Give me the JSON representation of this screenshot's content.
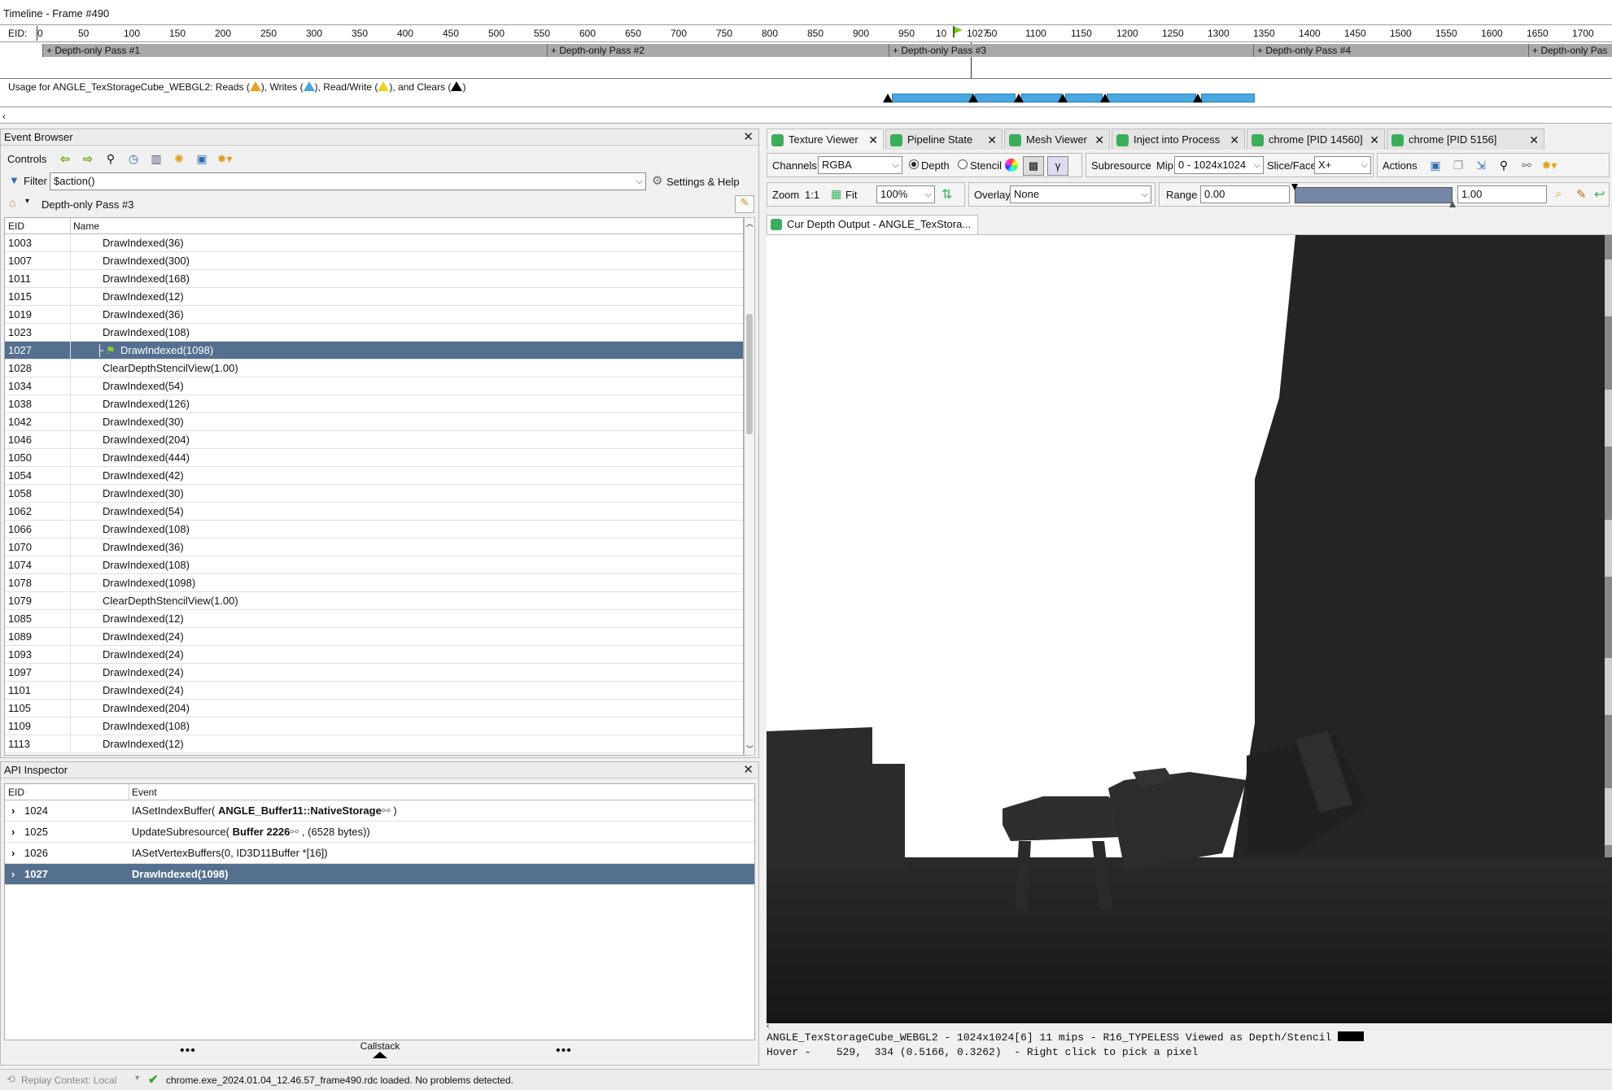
{
  "timeline": {
    "title": "Timeline - Frame #490",
    "eid_label": "EID:",
    "ticks": [
      "0",
      "50",
      "100",
      "150",
      "200",
      "250",
      "300",
      "350",
      "400",
      "450",
      "500",
      "550",
      "600",
      "650",
      "700",
      "750",
      "800",
      "850",
      "900",
      "950",
      "10",
      "1027",
      "50",
      "1100",
      "1150",
      "1200",
      "1250",
      "1300",
      "1350",
      "1400",
      "1450",
      "1500",
      "1550",
      "1600",
      "1650",
      "1700"
    ],
    "passes": [
      "+ Depth-only Pass #1",
      "+ Depth-only Pass #2",
      "+ Depth-only Pass #3",
      "+ Depth-only Pass #4",
      "+ Depth-only Pas"
    ],
    "usage": {
      "prefix": "Usage for ANGLE_TexStorageCube_WEBGL2: Reads (",
      "writes": "), Writes (",
      "readwrite": "), Read/Write (",
      "clears": "), and Clears (",
      "suffix": ")"
    }
  },
  "event_browser": {
    "title": "Event Browser",
    "controls_label": "Controls",
    "filter_label": "Filter",
    "filter_value": "$action()",
    "settings_label": "Settings & Help",
    "breadcrumb": "Depth-only Pass #3",
    "col_eid": "EID",
    "col_name": "Name",
    "rows": [
      {
        "eid": "1003",
        "name": "DrawIndexed(36)"
      },
      {
        "eid": "1007",
        "name": "DrawIndexed(300)"
      },
      {
        "eid": "1011",
        "name": "DrawIndexed(168)"
      },
      {
        "eid": "1015",
        "name": "DrawIndexed(12)"
      },
      {
        "eid": "1019",
        "name": "DrawIndexed(36)"
      },
      {
        "eid": "1023",
        "name": "DrawIndexed(108)"
      },
      {
        "eid": "1027",
        "name": "DrawIndexed(1098)"
      },
      {
        "eid": "1028",
        "name": "ClearDepthStencilView(1.00)"
      },
      {
        "eid": "1034",
        "name": "DrawIndexed(54)"
      },
      {
        "eid": "1038",
        "name": "DrawIndexed(126)"
      },
      {
        "eid": "1042",
        "name": "DrawIndexed(30)"
      },
      {
        "eid": "1046",
        "name": "DrawIndexed(204)"
      },
      {
        "eid": "1050",
        "name": "DrawIndexed(444)"
      },
      {
        "eid": "1054",
        "name": "DrawIndexed(42)"
      },
      {
        "eid": "1058",
        "name": "DrawIndexed(30)"
      },
      {
        "eid": "1062",
        "name": "DrawIndexed(54)"
      },
      {
        "eid": "1066",
        "name": "DrawIndexed(108)"
      },
      {
        "eid": "1070",
        "name": "DrawIndexed(36)"
      },
      {
        "eid": "1074",
        "name": "DrawIndexed(108)"
      },
      {
        "eid": "1078",
        "name": "DrawIndexed(1098)"
      },
      {
        "eid": "1079",
        "name": "ClearDepthStencilView(1.00)"
      },
      {
        "eid": "1085",
        "name": "DrawIndexed(12)"
      },
      {
        "eid": "1089",
        "name": "DrawIndexed(24)"
      },
      {
        "eid": "1093",
        "name": "DrawIndexed(24)"
      },
      {
        "eid": "1097",
        "name": "DrawIndexed(24)"
      },
      {
        "eid": "1101",
        "name": "DrawIndexed(24)"
      },
      {
        "eid": "1105",
        "name": "DrawIndexed(204)"
      },
      {
        "eid": "1109",
        "name": "DrawIndexed(108)"
      },
      {
        "eid": "1113",
        "name": "DrawIndexed(12)"
      }
    ]
  },
  "api_inspector": {
    "title": "API Inspector",
    "col_eid": "EID",
    "col_event": "Event",
    "rows": [
      {
        "eid": "1024",
        "pre": "IASetIndexBuffer( ",
        "bold": "ANGLE_Buffer11::NativeStorage",
        "post": " )"
      },
      {
        "eid": "1025",
        "pre": "UpdateSubresource( ",
        "bold": "Buffer 2226",
        "post": " , (6528 bytes))"
      },
      {
        "eid": "1026",
        "pre": "IASetVertexBuffers(0, ID3D11Buffer *[16])",
        "bold": "",
        "post": ""
      },
      {
        "eid": "1027",
        "pre": "",
        "bold": "DrawIndexed(1098)",
        "post": ""
      }
    ],
    "callstack_label": "Callstack"
  },
  "tabs": [
    "Texture Viewer",
    "Pipeline State",
    "Mesh Viewer",
    "Inject into Process",
    "chrome [PID 14560]",
    "chrome [PID 5156]"
  ],
  "texture_viewer": {
    "channels_label": "Channels",
    "channels_value": "RGBA",
    "depth_label": "Depth",
    "stencil_label": "Stencil",
    "gamma_label": "γ",
    "subresource_label": "Subresource",
    "mip_label": "Mip",
    "mip_value": "0 - 1024x1024",
    "slice_label": "Slice/Face",
    "slice_value": "X+",
    "actions_label": "Actions",
    "zoom_label": "Zoom",
    "zoom_1to1": "1:1",
    "fit_label": "Fit",
    "zoom_value": "100%",
    "overlay_label": "Overlay",
    "overlay_value": "None",
    "range_label": "Range",
    "range_min": "0.00",
    "range_max": "1.00",
    "subtab": "Cur Depth Output - ANGLE_TexStora...",
    "status1": "ANGLE_TexStorageCube_WEBGL2 - 1024x1024[6] 11 mips - R16_TYPELESS Viewed as Depth/Stencil",
    "status2": "Hover -    529,  334 (0.5166, 0.3262)  - Right click to pick a pixel"
  },
  "statusbar": {
    "replay": "Replay Context: Local",
    "message": "chrome.exe_2024.01.04_12.46.57_frame490.rdc loaded. No problems detected."
  }
}
